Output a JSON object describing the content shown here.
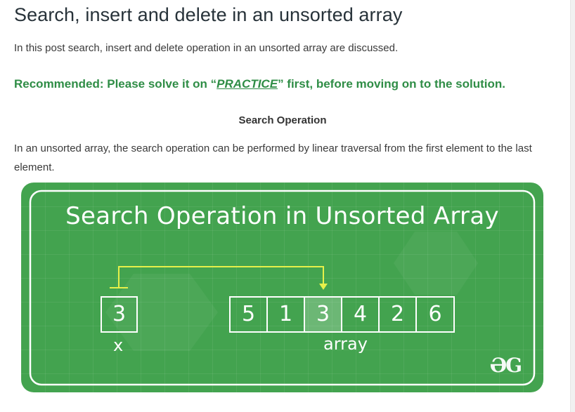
{
  "article": {
    "title": "Search, insert and delete in an unsorted array",
    "intro": "In this post search, insert and delete operation in an unsorted array are discussed.",
    "recommended": {
      "prefix": "Recommended: Please solve it on “",
      "link": "PRACTICE",
      "suffix": "” first, before moving on to the solution."
    },
    "section_heading": "Search Operation",
    "body": "In an unsorted array, the search operation can be performed by linear traversal from the first element to the last element."
  },
  "diagram": {
    "title": "Search Operation in Unsorted Array",
    "key_value": "3",
    "key_label": "x",
    "array_label": "array",
    "array": [
      "5",
      "1",
      "3",
      "4",
      "2",
      "6"
    ],
    "highlight_index": 2,
    "logo": "ƏG",
    "colors": {
      "panel": "#43a34f",
      "arrow": "#e6f04a",
      "text": "#ffffff",
      "heading_green": "#2f8d46"
    }
  }
}
